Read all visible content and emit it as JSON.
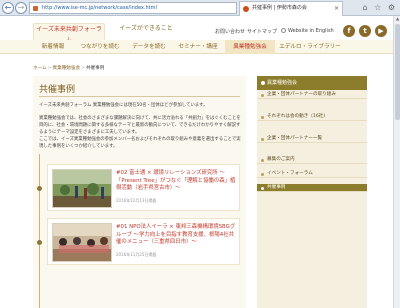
{
  "browser": {
    "url": "http://www.ise-mc.jp/network/case/index.html",
    "tab_title": "共催事例 | 伊勢市森の会",
    "back": "←",
    "forward": "→",
    "tools": "⌕ ▾ ↻",
    "close": "×",
    "window_icons": "⌂ ☆ ⚙"
  },
  "header": {
    "tab_forum": "イーズ未来共創フォーラム",
    "tab_eeds": "イーズができること",
    "inquiry": "お問い合わせ",
    "sitemap": "サイトマップ",
    "english": "Website in English",
    "sns": {
      "facebook": "f",
      "twitter": "t",
      "youtube": "▶"
    }
  },
  "nav": [
    "新着情報",
    "つながりを読む",
    "データを読む",
    "セミナー・講座",
    "異業種勉強会",
    "エデルロ・ライブラリー"
  ],
  "breadcrumb": {
    "home": "ホーム",
    "parent": "異業種勉強会",
    "current": "共催事例"
  },
  "content": {
    "title": "共催事例",
    "intro1": "イーズ未来共創フォーラム 異業種勉強会には現在50名・団体ほどが参加しています。",
    "intro2": "異業種勉強会では、社会のさまざまな課題解決に向けて、共に活力溢れる「共創力」をはぐくむことを目的に、社会・環境問題に関する多様なテーマと最新の動向について、できるだけわかりやすく解説するようにテーマ設定をさまざまに工夫しています。",
    "intro3": "ここでは、イーズ異業種勉強会の参加メンバー名およびそれぞれの取り組みや意義を選出することで実現した事例をいくつか紹介しています。",
    "cases": [
      {
        "title": "#02 富士通 × 環境リレーションズ研究所 〜「Present Tree」がつなぐ「理解と協働の森」植樹活動（岩手県宮古市）〜",
        "date": "2016年12月13日掲載"
      },
      {
        "title": "#01 NPO法人イーラ × 東邦三森機構環境SBGグループ 〜学力向上を目指す教育支援、栃陽4社共催のメニュー（三重県四日市）〜",
        "date": "2016年11月25日掲載"
      }
    ]
  },
  "sidebar": {
    "heading": "異業種勉強会",
    "items": [
      "企業・団体パートナーの取り組み",
      "それぞれは会の動き（16社)",
      "企業・団体パートナー一覧",
      "募集のご案内",
      "イベント・フォーラム",
      "共催事例"
    ],
    "active_index": 5
  },
  "colors": {
    "accent": "#c0392b",
    "olive": "#8b7d2c",
    "cream": "#faf6e8"
  }
}
